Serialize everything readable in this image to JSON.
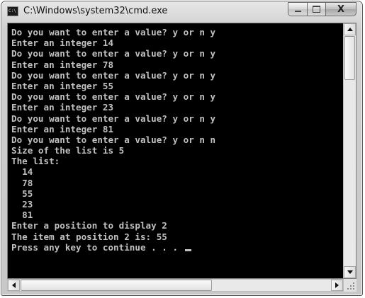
{
  "window": {
    "title": "C:\\Windows\\system32\\cmd.exe",
    "icon_text": "C:\\",
    "minimize_icon": "minimize-icon",
    "maximize_icon": "maximize-icon",
    "close_label": "X"
  },
  "console": {
    "lines": [
      "Do you want to enter a value? y or n y",
      "Enter an integer 14",
      "Do you want to enter a value? y or n y",
      "Enter an integer 78",
      "Do you want to enter a value? y or n y",
      "Enter an integer 55",
      "Do you want to enter a value? y or n y",
      "Enter an integer 23",
      "Do you want to enter a value? y or n y",
      "Enter an integer 81",
      "Do you want to enter a value? y or n n",
      "Size of the list is 5",
      "The list:",
      "  14",
      "  78",
      "  55",
      "  23",
      "  81",
      "Enter a position to display 2",
      "The item at position 2 is: 55",
      "Press any key to continue . . . "
    ],
    "text_color": "#c0c0c0",
    "background_color": "#000000"
  },
  "scrollbars": {
    "vertical": {
      "up_icon": "arrow-up-icon",
      "down_icon": "arrow-down-icon"
    },
    "horizontal": {
      "left_icon": "arrow-left-icon",
      "right_icon": "arrow-right-icon"
    }
  }
}
